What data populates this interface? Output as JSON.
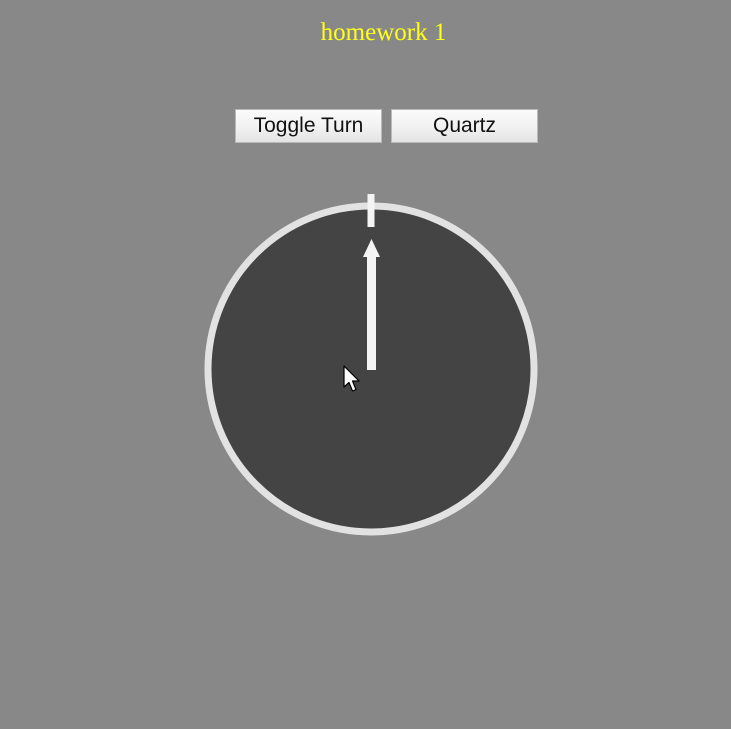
{
  "title": "homework 1",
  "toolbar": {
    "toggle_label": "Toggle Turn",
    "quartz_label": "Quartz"
  },
  "colors": {
    "background": "#888888",
    "title": "#ffff1a",
    "dial_face": "#444444",
    "dial_rim": "#e2e2e2",
    "hand": "#f4f4f4"
  },
  "dial": {
    "hand_angle_deg": 0
  },
  "icons": {
    "cursor": "mouse-pointer-icon"
  }
}
